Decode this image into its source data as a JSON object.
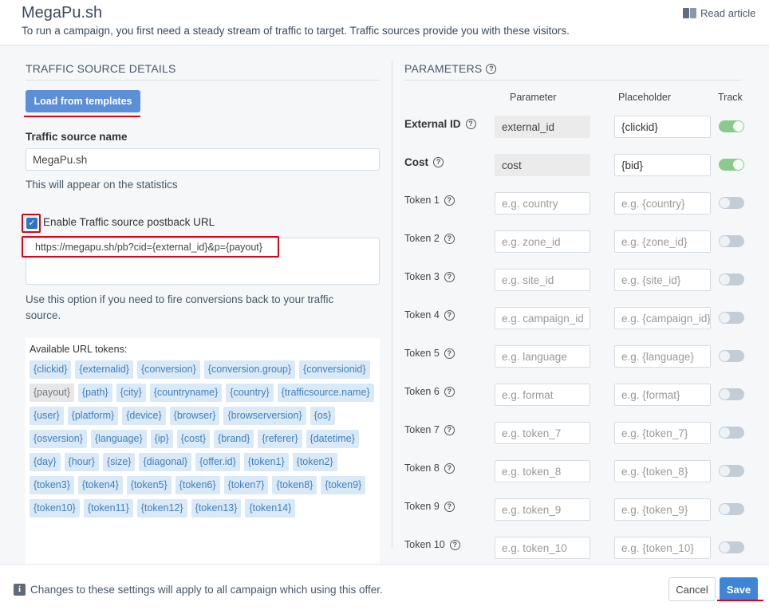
{
  "header": {
    "title": "MegaPu.sh",
    "subtitle": "To run a campaign, you first need a steady stream of traffic to target. Traffic sources provide you with these visitors.",
    "read_article": "Read article"
  },
  "left": {
    "section_title": "TRAFFIC SOURCE DETAILS",
    "load_button": "Load from templates",
    "name_label": "Traffic source name",
    "name_value": "MegaPu.sh",
    "name_hint": "This will appear on the statistics",
    "postback_checkbox_label": "Enable Traffic source postback URL",
    "postback_checked": true,
    "postback_url": "https://megapu.sh/pb?cid={external_id}&p={payout}",
    "postback_hint": "Use this option if you need to fire conversions back to your traffic source.",
    "tokens_title": "Available URL tokens:",
    "tokens": [
      "{clickid}",
      "{externalid}",
      "{conversion}",
      "{conversion.group}",
      "{conversionid}",
      "{payout}",
      "{path}",
      "{city}",
      "{countryname}",
      "{country}",
      "{trafficsource.name}",
      "{user}",
      "{platform}",
      "{device}",
      "{browser}",
      "{browserversion}",
      "{os}",
      "{osversion}",
      "{language}",
      "{ip}",
      "{cost}",
      "{brand}",
      "{referer}",
      "{datetime}",
      "{day}",
      "{hour}",
      "{size}",
      "{diagonal}",
      "{offer.id}",
      "{token1}",
      "{token2}",
      "{token3}",
      "{token4}",
      "{token5}",
      "{token6}",
      "{token7}",
      "{token8}",
      "{token9}",
      "{token10}",
      "{token11}",
      "{token12}",
      "{token13}",
      "{token14}"
    ],
    "token_gray_index": 5
  },
  "right": {
    "section_title": "PARAMETERS",
    "col_parameter": "Parameter",
    "col_placeholder": "Placeholder",
    "col_track": "Track",
    "rows": [
      {
        "label": "External ID",
        "bold": true,
        "param": "external_id",
        "param_readonly": true,
        "placeholder": "{clickid}",
        "placeholder_is_value": true,
        "track": true
      },
      {
        "label": "Cost",
        "bold": true,
        "param": "cost",
        "param_readonly": true,
        "placeholder": "{bid}",
        "placeholder_is_value": true,
        "track": true
      },
      {
        "label": "Token 1",
        "param": "e.g. country",
        "placeholder": "e.g. {country}",
        "track": false
      },
      {
        "label": "Token 2",
        "param": "e.g. zone_id",
        "placeholder": "e.g. {zone_id}",
        "track": false
      },
      {
        "label": "Token 3",
        "param": "e.g. site_id",
        "placeholder": "e.g. {site_id}",
        "track": false
      },
      {
        "label": "Token 4",
        "param": "e.g. campaign_id",
        "placeholder": "e.g. {campaign_id}",
        "track": false
      },
      {
        "label": "Token 5",
        "param": "e.g. language",
        "placeholder": "e.g. {language}",
        "track": false
      },
      {
        "label": "Token 6",
        "param": "e.g. format",
        "placeholder": "e.g. {format}",
        "track": false
      },
      {
        "label": "Token 7",
        "param": "e.g. token_7",
        "placeholder": "e.g. {token_7}",
        "track": false
      },
      {
        "label": "Token 8",
        "param": "e.g. token_8",
        "placeholder": "e.g. {token_8}",
        "track": false
      },
      {
        "label": "Token 9",
        "param": "e.g. token_9",
        "placeholder": "e.g. {token_9}",
        "track": false
      },
      {
        "label": "Token 10",
        "param": "e.g. token_10",
        "placeholder": "e.g. {token_10}",
        "track": false
      }
    ]
  },
  "footer": {
    "info_text": "Changes to these settings will apply to all campaign which using this offer.",
    "cancel": "Cancel",
    "save": "Save"
  }
}
